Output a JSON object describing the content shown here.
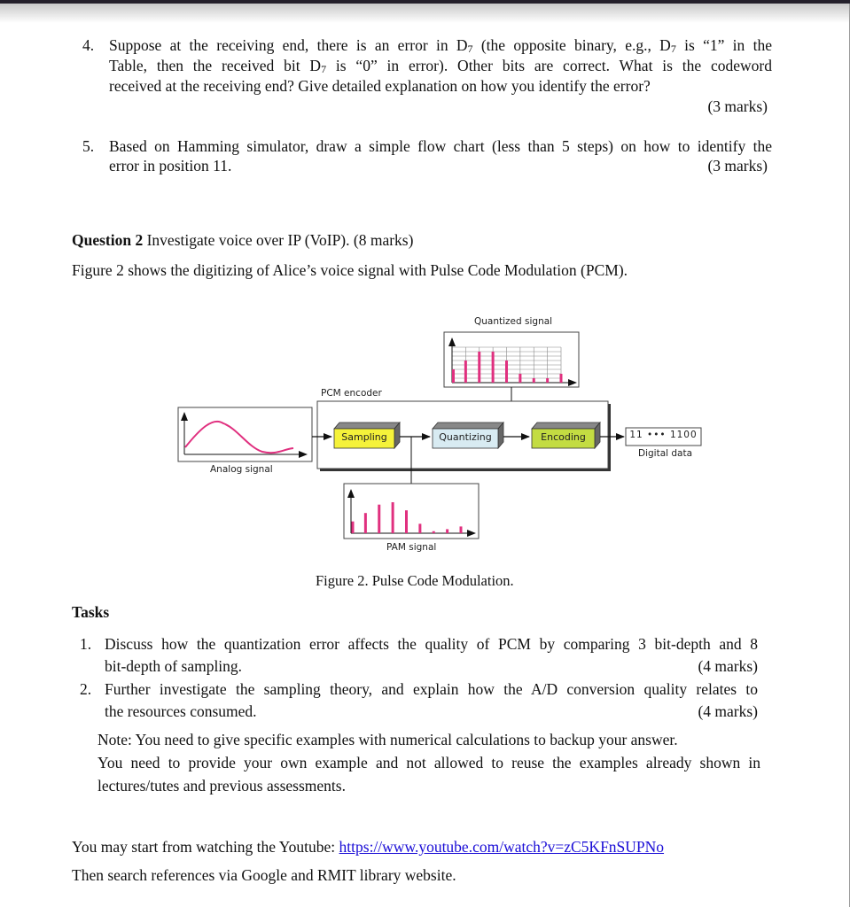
{
  "question1_items": {
    "q4": {
      "number": "4.",
      "line1_a": "Suppose at the receiving end, there is an error in D",
      "line1_sub1": "7",
      "line1_b": " (the opposite binary, e.g., D",
      "line1_sub2": "7",
      "line1_c": " is “1” in the",
      "line2_a": "Table, then the received bit D",
      "line2_sub": "7",
      "line2_b": " is “0” in error). Other bits are correct. What is the codeword",
      "line3": "received at the receiving end? Give detailed explanation on how you identify the error?",
      "marks": "(3 marks)"
    },
    "q5": {
      "number": "5.",
      "line1": "Based on Hamming simulator, draw a simple flow chart (less than 5 steps) on how to identify the",
      "line2": "error in position 11.",
      "marks": "(3 marks)"
    }
  },
  "question2": {
    "heading_bold": "Question 2",
    "heading_rest": " Investigate voice over IP (VoIP). (8 marks)",
    "intro": "Figure 2 shows the digitizing of Alice’s voice signal with Pulse Code Modulation (PCM)."
  },
  "figure": {
    "quantized_label": "Quantized signal",
    "pcm_encoder_label": "PCM encoder",
    "analog_label": "Analog signal",
    "pam_label": "PAM signal",
    "sampling_label": "Sampling",
    "quantizing_label": "Quantizing",
    "encoding_label": "Encoding",
    "digital_value": "11 ••• 1100",
    "digital_label": "Digital data",
    "caption": "Figure 2. Pulse Code Modulation.",
    "pulse_heights": [
      0.35,
      0.6,
      0.85,
      0.92,
      0.68,
      0.28,
      0.06,
      0.12,
      0.2
    ],
    "colors": {
      "signal": "#e0307f",
      "sampling": "#f5f23a",
      "quantizing": "#d8ebf2",
      "encoding": "#c3dc42"
    }
  },
  "tasks": {
    "heading": "Tasks",
    "items": [
      {
        "number": "1.",
        "line1": "Discuss how the quantization error affects the quality of PCM by comparing 3 bit-depth and 8",
        "line2": "bit-depth of sampling.",
        "marks": "(4 marks)"
      },
      {
        "number": "2.",
        "line1": "Further investigate the sampling theory, and explain how the A/D conversion quality relates to",
        "line2": "the resources consumed.",
        "marks": "(4 marks)"
      }
    ],
    "note_line1": "Note: You need to give specific examples with numerical calculations to backup your answer.",
    "note_line2": "You need to provide your own example and not allowed to reuse the examples already shown in",
    "note_line3": "lectures/tutes and previous assessments."
  },
  "footer": {
    "youtube_prefix": "You may start from watching the Youtube: ",
    "youtube_link": "https://www.youtube.com/watch?v=zC5KFnSUPNo",
    "references": "Then search references via Google and RMIT library website."
  }
}
